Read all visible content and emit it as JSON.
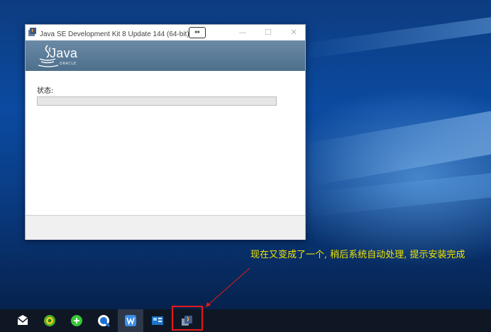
{
  "window": {
    "title": "Java SE Development Kit 8 Update 144 (64-bit) - 完",
    "cursor_glyph": "⇔",
    "min_glyph": "—",
    "max_glyph": "☐",
    "close_glyph": "✕",
    "banner": {
      "logo_text": "Java",
      "logo_sub": "ORACLE"
    },
    "status_label": "状态:",
    "progress_percent": 0
  },
  "annotation": {
    "text": "现在又变成了一个, 稍后系统自动处理, 提示安装完成",
    "color": "#f2e600"
  },
  "taskbar": {
    "items": [
      {
        "name": "mail-icon"
      },
      {
        "name": "app-360-icon"
      },
      {
        "name": "app-green-icon"
      },
      {
        "name": "app-browser-icon"
      },
      {
        "name": "wps-writer-icon"
      },
      {
        "name": "control-panel-icon"
      },
      {
        "name": "java-installer-icon"
      }
    ],
    "highlight_color": "#e41a1a"
  }
}
